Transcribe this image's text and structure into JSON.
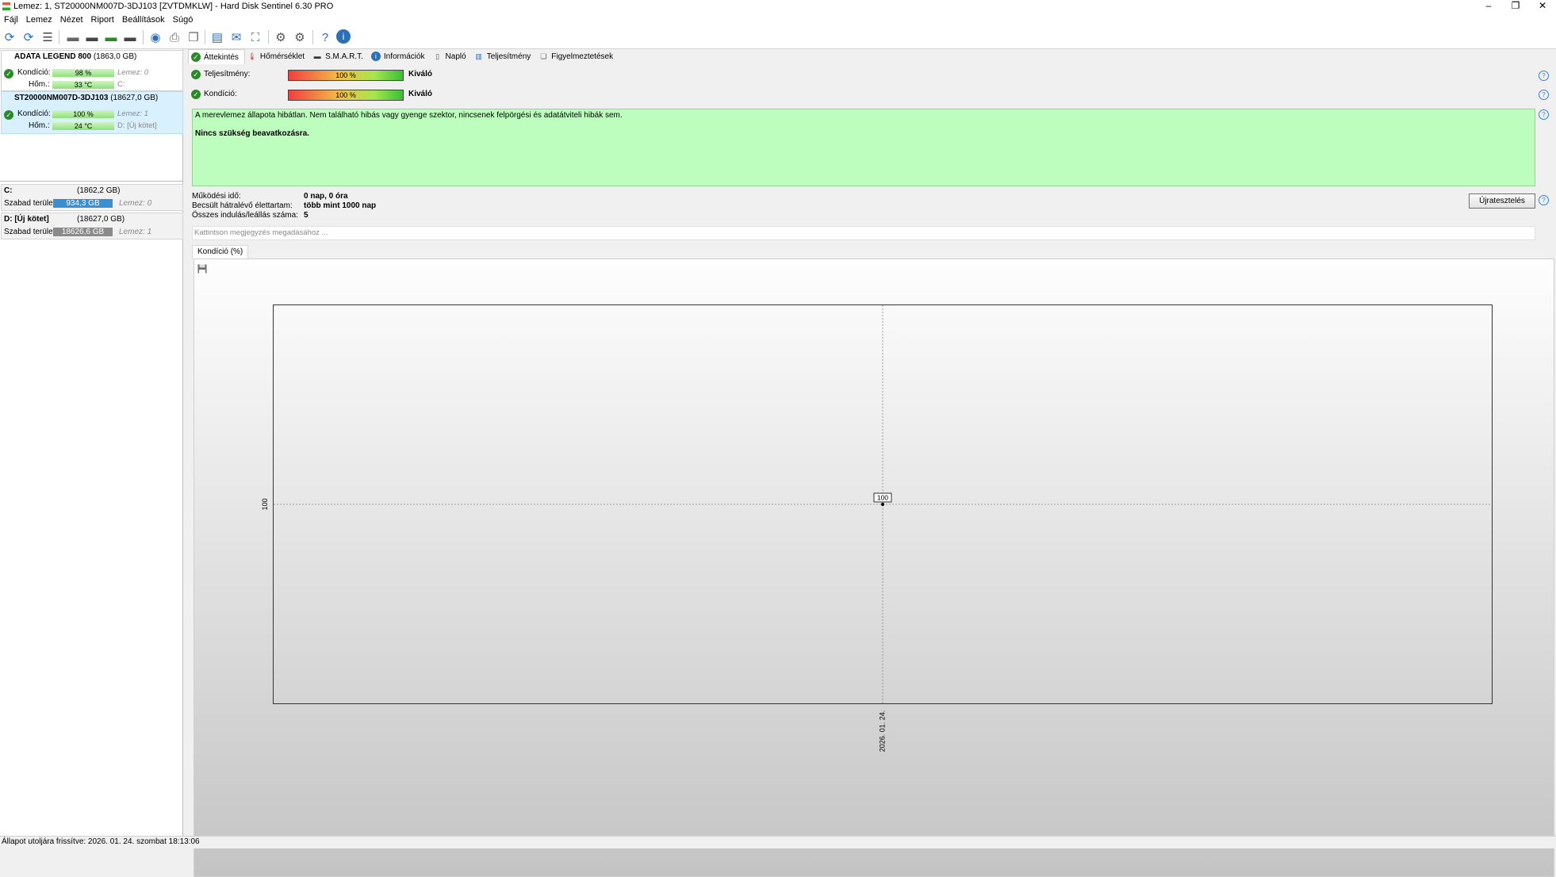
{
  "window": {
    "title": "Lemez: 1, ST20000NM007D-3DJ103 [ZVTDMKLW]  -  Hard Disk Sentinel 6.30 PRO",
    "controls": [
      "–",
      "❐",
      "✕"
    ]
  },
  "menu": [
    "Fájl",
    "Lemez",
    "Nézet",
    "Riport",
    "Beállítások",
    "Súgó"
  ],
  "disks": [
    {
      "name": "ADATA LEGEND 800",
      "size": "(1863,0 GB)",
      "condition_label": "Kondíció:",
      "condition_value": "98 %",
      "temp_label": "Hőm.:",
      "temp_value": "33 °C",
      "disk_label": "Lemez: 0",
      "drive_label": "C:"
    },
    {
      "name": "ST20000NM007D-3DJ103",
      "size": "(18627,0 GB)",
      "condition_label": "Kondíció:",
      "condition_value": "100 %",
      "temp_label": "Hőm.:",
      "temp_value": "24 °C",
      "disk_label": "Lemez: 1",
      "drive_label": "D: [Új kötet]"
    }
  ],
  "volumes": [
    {
      "name": "C:",
      "size": "(1862,2 GB)",
      "free_label": "Szabad terület",
      "free_value": "934,3 GB",
      "bar_color": "#3a8fd0",
      "disk_label": "Lemez: 0"
    },
    {
      "name": "D: [Új kötet]",
      "size": "(18627,0 GB)",
      "free_label": "Szabad terület",
      "free_value": "18626,6 GB",
      "bar_color": "#8a8a8a",
      "disk_label": "Lemez: 1"
    }
  ],
  "tabs": [
    {
      "label": "Áttekintés",
      "icon": "check-circle-icon"
    },
    {
      "label": "Hőmérséklet",
      "icon": "thermometer-icon"
    },
    {
      "label": "S.M.A.R.T.",
      "icon": "drive-icon"
    },
    {
      "label": "Információk",
      "icon": "info-icon"
    },
    {
      "label": "Napló",
      "icon": "document-icon"
    },
    {
      "label": "Teljesítmény",
      "icon": "performance-icon"
    },
    {
      "label": "Figyelmeztetések",
      "icon": "alerts-icon"
    }
  ],
  "overview": {
    "performance_label": "Teljesítmény:",
    "performance_value": "100 %",
    "performance_rating": "Kiváló",
    "condition_label": "Kondíció:",
    "condition_value": "100 %",
    "condition_rating": "Kiváló",
    "status_text": "A merevlemez állapota hibátlan. Nem található hibás vagy gyenge szektor, nincsenek felpörgési és adatátviteli hibák sem.",
    "recommendation": "Nincs szükség beavatkozásra.",
    "power_on_label": "Működési idő:",
    "power_on_value": "0 nap, 0 óra",
    "lifetime_label": "Becsült hátralévő élettartam:",
    "lifetime_value": "több mint 1000 nap",
    "startstop_label": "Összes indulás/leállás száma:",
    "startstop_value": "5",
    "retest_button": "Újratesztelés",
    "note_placeholder": "Kattintson megjegyzés megadásához ..."
  },
  "chart_tab": "Kondíció  (%)",
  "chart_data": {
    "type": "line",
    "x": [
      "2026. 01. 24."
    ],
    "y_ticks": [
      "100"
    ],
    "series": [
      {
        "values": [
          100
        ],
        "labels": [
          "100"
        ]
      }
    ]
  },
  "status_bar": "Állapot utoljára frissítve: 2026. 01. 24. szombat 18:13:06"
}
